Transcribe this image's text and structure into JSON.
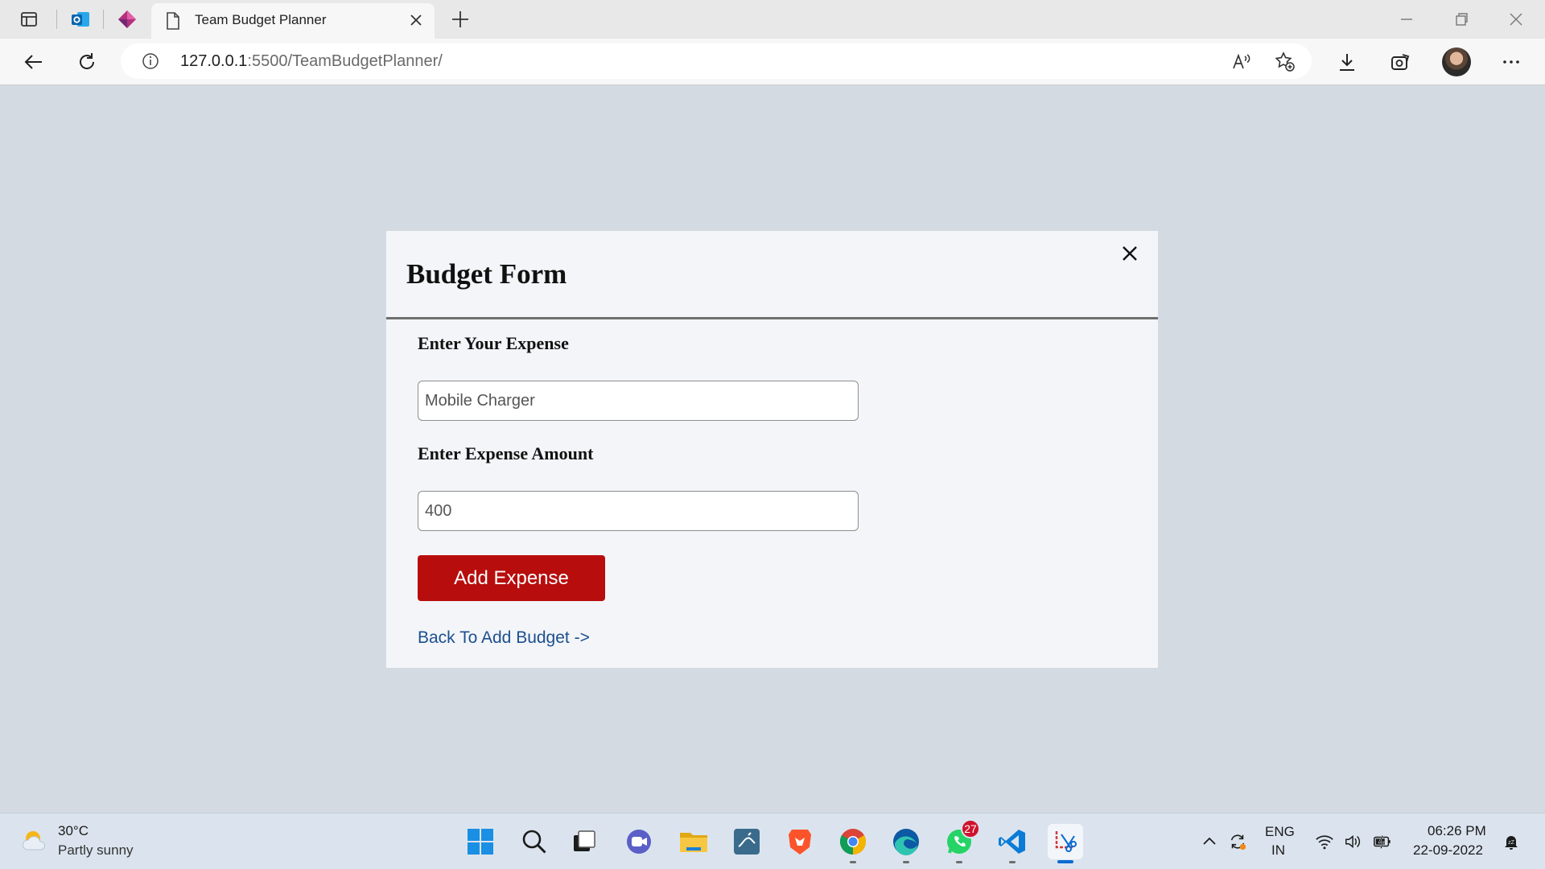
{
  "browser": {
    "tab_title": "Team Budget Planner",
    "url_host": "127.0.0.1",
    "url_rest": ":5500/TeamBudgetPlanner/"
  },
  "modal": {
    "title": "Budget Form",
    "expense_label": "Enter Your Expense",
    "expense_value": "Mobile Charger",
    "amount_label": "Enter Expense Amount",
    "amount_value": "400",
    "submit_label": "Add Expense",
    "back_link": "Back To Add Budget ->"
  },
  "taskbar": {
    "weather_temp": "30°C",
    "weather_desc": "Partly sunny",
    "whatsapp_badge": "27",
    "lang_primary": "ENG",
    "lang_secondary": "IN",
    "time": "06:26 PM",
    "date": "22-09-2022"
  },
  "icons": [
    "sidebar-icon",
    "outlook-icon",
    "power-apps-icon",
    "page-icon",
    "close-icon",
    "plus-icon",
    "minimize-icon",
    "restore-icon",
    "back-icon",
    "refresh-icon",
    "info-icon",
    "read-aloud-icon",
    "favorite-icon",
    "download-icon",
    "extensions-icon",
    "more-icon",
    "windows-start-icon",
    "search-icon",
    "task-view-icon",
    "teams-chat-icon",
    "file-explorer-icon",
    "mysql-icon",
    "brave-icon",
    "chrome-icon",
    "edge-icon",
    "whatsapp-icon",
    "vscode-icon",
    "snipping-tool-icon",
    "chevron-up-icon",
    "sync-icon",
    "wifi-icon",
    "volume-icon",
    "battery-icon",
    "notification-icon",
    "weather-icon"
  ],
  "colors": {
    "page_bg": "#d3dae2",
    "modal_bg": "#f4f5f8",
    "button": "#b80d0d",
    "link": "#1c4f8f"
  }
}
